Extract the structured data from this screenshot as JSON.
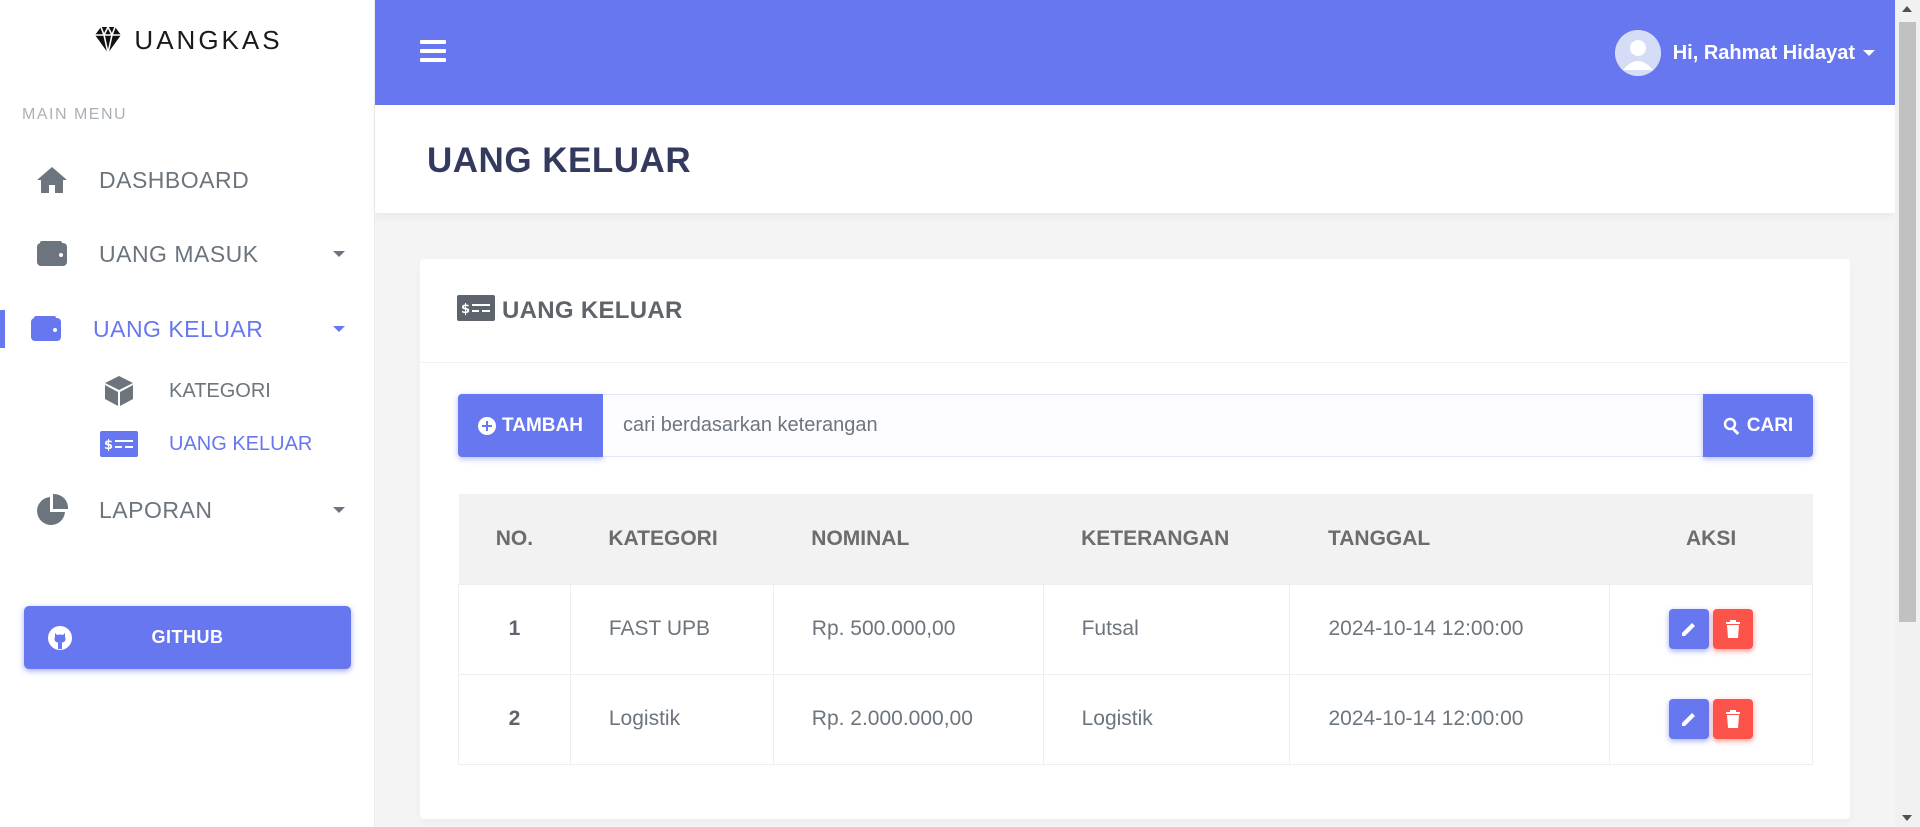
{
  "brand": {
    "name": "UANGKAS",
    "icon": "gem-icon"
  },
  "sidebar": {
    "menu_header": "MAIN MENU",
    "items": [
      {
        "label": "DASHBOARD",
        "icon": "home-icon"
      },
      {
        "label": "UANG MASUK",
        "icon": "wallet-icon"
      },
      {
        "label": "UANG KELUAR",
        "icon": "wallet-icon"
      },
      {
        "label": "LAPORAN",
        "icon": "pie-chart-icon"
      }
    ],
    "sub_items": [
      {
        "label": "KATEGORI",
        "icon": "cube-icon"
      },
      {
        "label": "UANG KELUAR",
        "icon": "money-check-icon"
      }
    ],
    "github_label": "GITHUB"
  },
  "topbar": {
    "greeting": "Hi, Rahmat Hidayat"
  },
  "page": {
    "title": "UANG KELUAR"
  },
  "card": {
    "title": "UANG KELUAR",
    "add_label": "TAMBAH",
    "search_placeholder": "cari berdasarkan keterangan",
    "search_label": "CARI"
  },
  "table": {
    "headers": [
      "NO.",
      "KATEGORI",
      "NOMINAL",
      "KETERANGAN",
      "TANGGAL",
      "AKSI"
    ],
    "rows": [
      {
        "no": "1",
        "kategori": "FAST UPB",
        "nominal": "Rp. 500.000,00",
        "keterangan": "Futsal",
        "tanggal": "2024-10-14 12:00:00"
      },
      {
        "no": "2",
        "kategori": "Logistik",
        "nominal": "Rp. 2.000.000,00",
        "keterangan": "Logistik",
        "tanggal": "2024-10-14 12:00:00"
      }
    ]
  },
  "colors": {
    "primary": "#6777ef",
    "danger": "#fc544b",
    "title": "#34395e",
    "muted": "#6c757d"
  }
}
